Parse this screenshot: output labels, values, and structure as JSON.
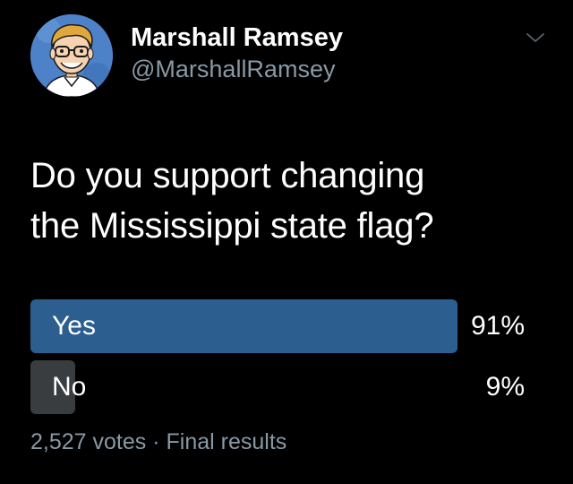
{
  "author": {
    "display_name": "Marshall Ramsey",
    "handle": "@MarshallRamsey",
    "avatar_icon": "caricature-avatar",
    "menu_icon": "chevron-down-icon"
  },
  "tweet": {
    "line1": "Do you support changing",
    "line2": "the Mississippi state flag?"
  },
  "poll": {
    "options": [
      {
        "label": "Yes",
        "percent_text": "91%",
        "fraction": 0.91,
        "leading": true
      },
      {
        "label": "No",
        "percent_text": "9%",
        "fraction": 0.09,
        "leading": false
      }
    ],
    "votes_text": "2,527 votes",
    "separator": "·",
    "status_text": "Final results"
  },
  "colors": {
    "background": "#000000",
    "leading_bar": "#2c5f8f",
    "other_bar": "#3a3d40",
    "secondary_text": "#8899a6",
    "primary_text": "#ffffff"
  }
}
